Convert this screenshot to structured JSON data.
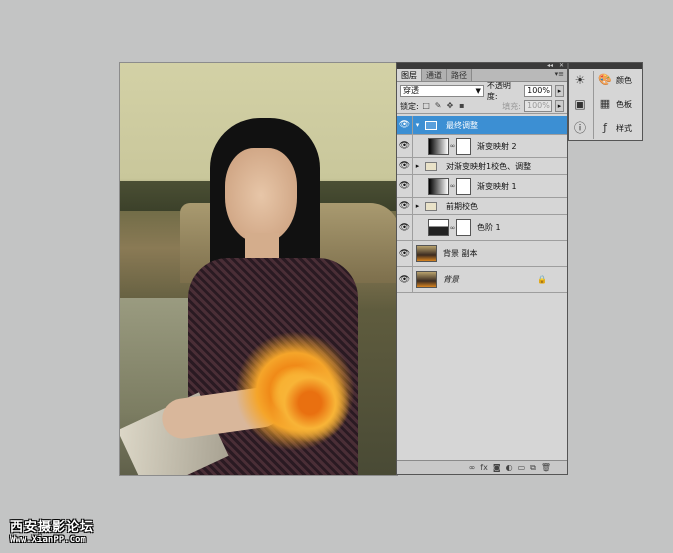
{
  "panel": {
    "tabs": [
      {
        "label": "图层",
        "active": true
      },
      {
        "label": "通道",
        "active": false
      },
      {
        "label": "路径",
        "active": false
      }
    ],
    "blend_mode": "穿透",
    "opacity_label": "不透明度:",
    "opacity_value": "100%",
    "lock_label": "锁定:",
    "fill_label": "填充:",
    "fill_value": "100%",
    "layers": [
      {
        "name": "最终调整",
        "type": "group",
        "selected": true
      },
      {
        "name": "渐变映射 2",
        "type": "gradient-adjust"
      },
      {
        "name": "对渐变映射1校色、调整",
        "type": "group"
      },
      {
        "name": "渐变映射 1",
        "type": "gradient-adjust"
      },
      {
        "name": "前期校色",
        "type": "group"
      },
      {
        "name": "色阶 1",
        "type": "levels-adjust"
      },
      {
        "name": "背景 副本",
        "type": "image"
      },
      {
        "name": "背景",
        "type": "image-locked"
      }
    ],
    "bottom_icons": [
      "link-icon",
      "fx-icon",
      "mask-icon",
      "adjustment-icon",
      "folder-icon",
      "new-layer-icon",
      "trash-icon"
    ]
  },
  "dock": {
    "items": [
      {
        "label": "颜色",
        "icon": "color-icon"
      },
      {
        "label": "色板",
        "icon": "swatches-icon"
      },
      {
        "label": "样式",
        "icon": "styles-icon"
      }
    ]
  },
  "watermark": {
    "line1": "西安摄影论坛",
    "line2": "Www.XianPP.Com"
  }
}
